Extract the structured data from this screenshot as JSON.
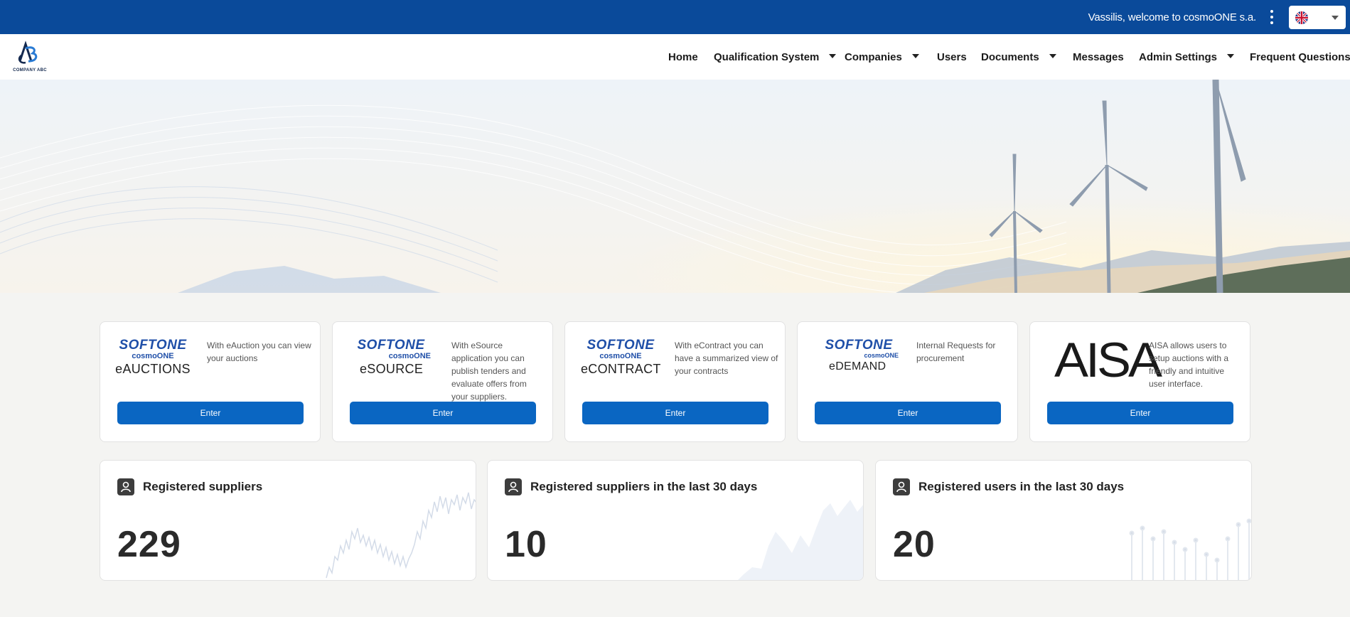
{
  "header": {
    "welcome": "Vassilis, welcome to cosmoONE s.a.",
    "menu_icon": "more-vert-icon",
    "language_icon": "uk-flag-icon"
  },
  "logo": {
    "text": "COMPANY ABC"
  },
  "nav": {
    "items": [
      {
        "label": "Home"
      },
      {
        "label": "Qualification System"
      },
      {
        "label": "Companies"
      },
      {
        "label": "Users"
      },
      {
        "label": "Documents"
      },
      {
        "label": "Messages"
      },
      {
        "label": "Admin Settings"
      },
      {
        "label": "Frequent Questions"
      }
    ]
  },
  "apps": [
    {
      "brand": "SOFTONE",
      "sub": "cosmoONE",
      "product": "eAUCTIONS",
      "description": "With eAuction you can view your auctions",
      "button": "Enter"
    },
    {
      "brand": "SOFTONE",
      "sub": "cosmoONE",
      "product": "eSOURCE",
      "description": "With eSource application you can publish tenders and evaluate offers from your suppliers.",
      "button": "Enter"
    },
    {
      "brand": "SOFTONE",
      "sub": "cosmoONE",
      "product": "eCONTRACT",
      "description": "With eContract you can have a summarized view of your contracts",
      "button": "Enter"
    },
    {
      "brand": "SOFTONE",
      "sub": "cosmoONE",
      "product": "eDEMAND",
      "description": "Internal Requests for procurement",
      "button": "Enter"
    },
    {
      "brand": "AISA",
      "description": "AISA allows users to setup auctions with a friendly and intuitive user interface.",
      "button": "Enter"
    }
  ],
  "stats": [
    {
      "title": "Registered suppliers",
      "value": "229",
      "icon": "user-badge-icon"
    },
    {
      "title": "Registered suppliers in the last 30 days",
      "value": "10",
      "icon": "user-badge-icon"
    },
    {
      "title": "Registered users in the last 30 days",
      "value": "20",
      "icon": "user-badge-icon"
    }
  ],
  "colors": {
    "topbar": "#0a4a9a",
    "accent": "#0a66c2",
    "brand_blue": "#1f4fa8"
  }
}
